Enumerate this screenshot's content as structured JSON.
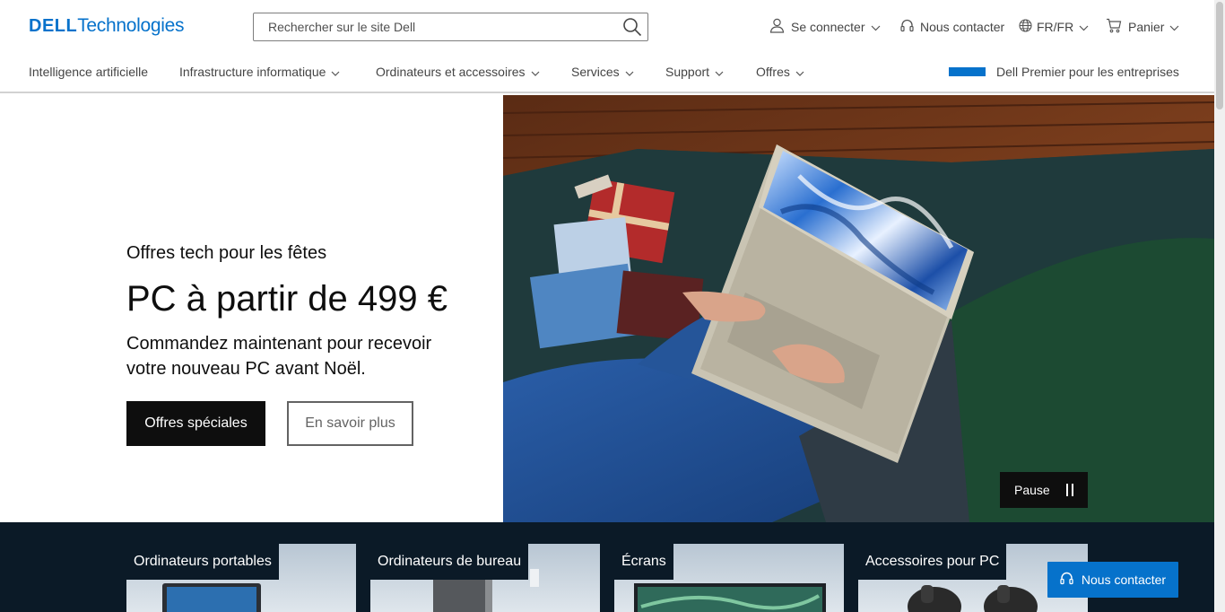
{
  "brand": {
    "logo_primary": "DELL",
    "logo_secondary": "Technologies",
    "accent": "#0672cb"
  },
  "search": {
    "placeholder": "Rechercher sur le site Dell"
  },
  "utility": {
    "signin": "Se connecter",
    "contact": "Nous contacter",
    "language": "FR/FR",
    "cart": "Panier"
  },
  "nav": {
    "items": [
      {
        "label": "Intelligence artificielle",
        "has_menu": false
      },
      {
        "label": "Infrastructure informatique",
        "has_menu": true
      },
      {
        "label": "Ordinateurs et accessoires",
        "has_menu": true
      },
      {
        "label": "Services",
        "has_menu": true
      },
      {
        "label": "Support",
        "has_menu": true
      },
      {
        "label": "Offres",
        "has_menu": true
      }
    ],
    "premier": "Dell Premier pour les entreprises"
  },
  "hero": {
    "eyebrow": "Offres tech pour les fêtes",
    "headline": "PC à partir de 499 €",
    "subtext": "Commandez maintenant pour recevoir votre nouveau PC avant Noël.",
    "primary_cta": "Offres spéciales",
    "secondary_cta": "En savoir plus",
    "pause_label": "Pause"
  },
  "categories": [
    {
      "label": "Ordinateurs portables"
    },
    {
      "label": "Ordinateurs de bureau"
    },
    {
      "label": "Écrans"
    },
    {
      "label": "Accessoires pour PC"
    }
  ],
  "floating_contact": "Nous contacter"
}
